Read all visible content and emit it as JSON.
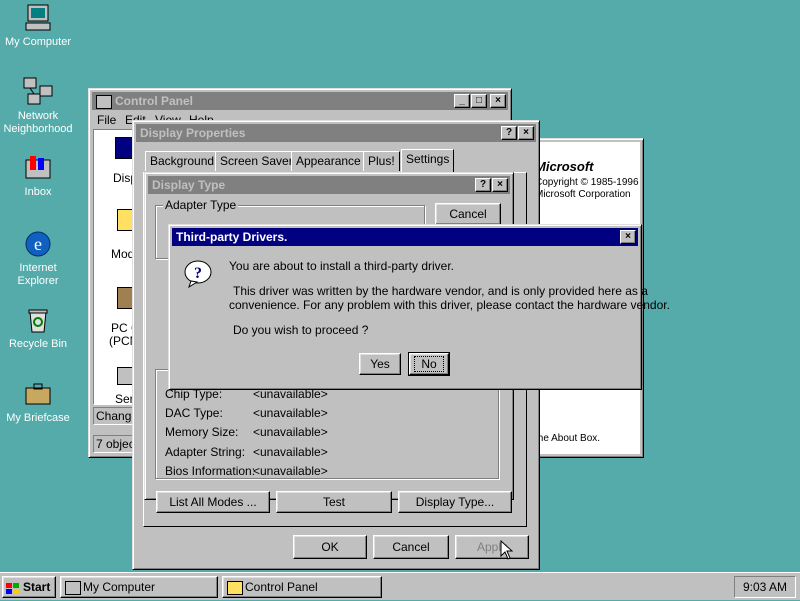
{
  "desktop": {
    "icons": [
      {
        "label": "My Computer",
        "icon": "computer-icon"
      },
      {
        "label": "Network Neighborhood",
        "icon": "network-icon"
      },
      {
        "label": "Inbox",
        "icon": "inbox-icon"
      },
      {
        "label": "Internet Explorer",
        "icon": "ie-icon"
      },
      {
        "label": "Recycle Bin",
        "icon": "recycle-bin-icon"
      },
      {
        "label": "My Briefcase",
        "icon": "briefcase-icon"
      }
    ]
  },
  "control_panel": {
    "title": "Control Panel",
    "menu": [
      "File",
      "Edit",
      "View",
      "Help"
    ],
    "items_partial": [
      "Disp",
      "Mod",
      "PC C",
      "(PCM",
      "Ser"
    ],
    "status_left": "7 object",
    "change_btn": "Change"
  },
  "about_window": {
    "brand": "Microsoft",
    "copyright": "Copyright © 1985-1996",
    "corp": "Microsoft Corporation",
    "about_box": "the About Box."
  },
  "display_properties": {
    "title": "Display Properties",
    "tabs": [
      "Background",
      "Screen Saver",
      "Appearance",
      "Plus!",
      "Settings"
    ],
    "buttons": {
      "ok": "OK",
      "cancel": "Cancel",
      "apply": "Apply"
    }
  },
  "display_type": {
    "title": "Display Type",
    "adapter_type_label": "Adapter Type",
    "cancel": "Cancel",
    "info": [
      {
        "label": "Chip Type:",
        "value": "<unavailable>"
      },
      {
        "label": "DAC Type:",
        "value": "<unavailable>"
      },
      {
        "label": "Memory Size:",
        "value": "<unavailable>"
      },
      {
        "label": "Adapter String:",
        "value": "<unavailable>"
      },
      {
        "label": "Bios Information:",
        "value": "<unavailable>"
      }
    ],
    "bottom_buttons": {
      "list_all_modes": "List All Modes ...",
      "test": "Test",
      "display_type": "Display Type..."
    }
  },
  "dialog": {
    "title": "Third-party Drivers.",
    "line1": "You are about to install a third-party driver.",
    "line2": "This driver was written by the hardware vendor, and is only provided here as a",
    "line3": "convenience.  For any problem with this driver, please contact the hardware vendor.",
    "question": "Do you wish to proceed ?",
    "yes": "Yes",
    "no": "No"
  },
  "taskbar": {
    "start": "Start",
    "tasks": [
      {
        "label": "My Computer",
        "icon": "computer-icon"
      },
      {
        "label": "Control Panel",
        "icon": "control-panel-icon"
      }
    ],
    "clock": "9:03 AM"
  }
}
